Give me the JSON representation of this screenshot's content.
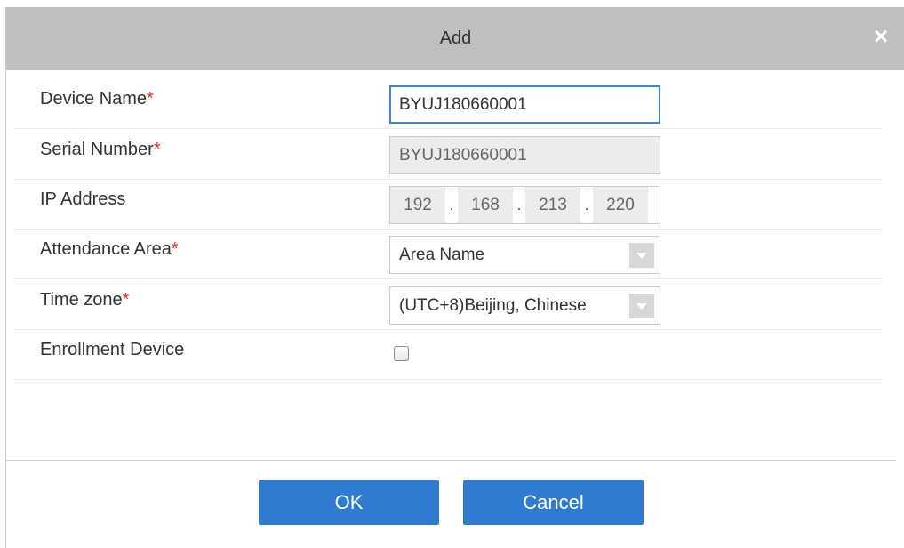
{
  "dialog": {
    "title": "Add",
    "close_glyph": "×"
  },
  "form": {
    "device_name": {
      "label": "Device Name",
      "required_mark": "*",
      "value": "BYUJ180660001"
    },
    "serial_number": {
      "label": "Serial Number",
      "required_mark": "*",
      "value": "BYUJ180660001"
    },
    "ip_address": {
      "label": "IP Address",
      "octets": [
        "192",
        "168",
        "213",
        "220"
      ],
      "separator": "."
    },
    "attendance_area": {
      "label": "Attendance Area",
      "required_mark": "*",
      "selected": "Area Name"
    },
    "time_zone": {
      "label": "Time zone",
      "required_mark": "*",
      "selected": "(UTC+8)Beijing, Chinese"
    },
    "enrollment_device": {
      "label": "Enrollment Device",
      "checked": false
    }
  },
  "buttons": {
    "ok": "OK",
    "cancel": "Cancel"
  },
  "colors": {
    "titlebar": "#bfbfbf",
    "primary_button": "#2f7bd2",
    "required": "#e62e2e",
    "focus_border": "#4a84c4"
  },
  "icons": {
    "close": "close-icon",
    "dropdown": "chevron-down-icon"
  }
}
